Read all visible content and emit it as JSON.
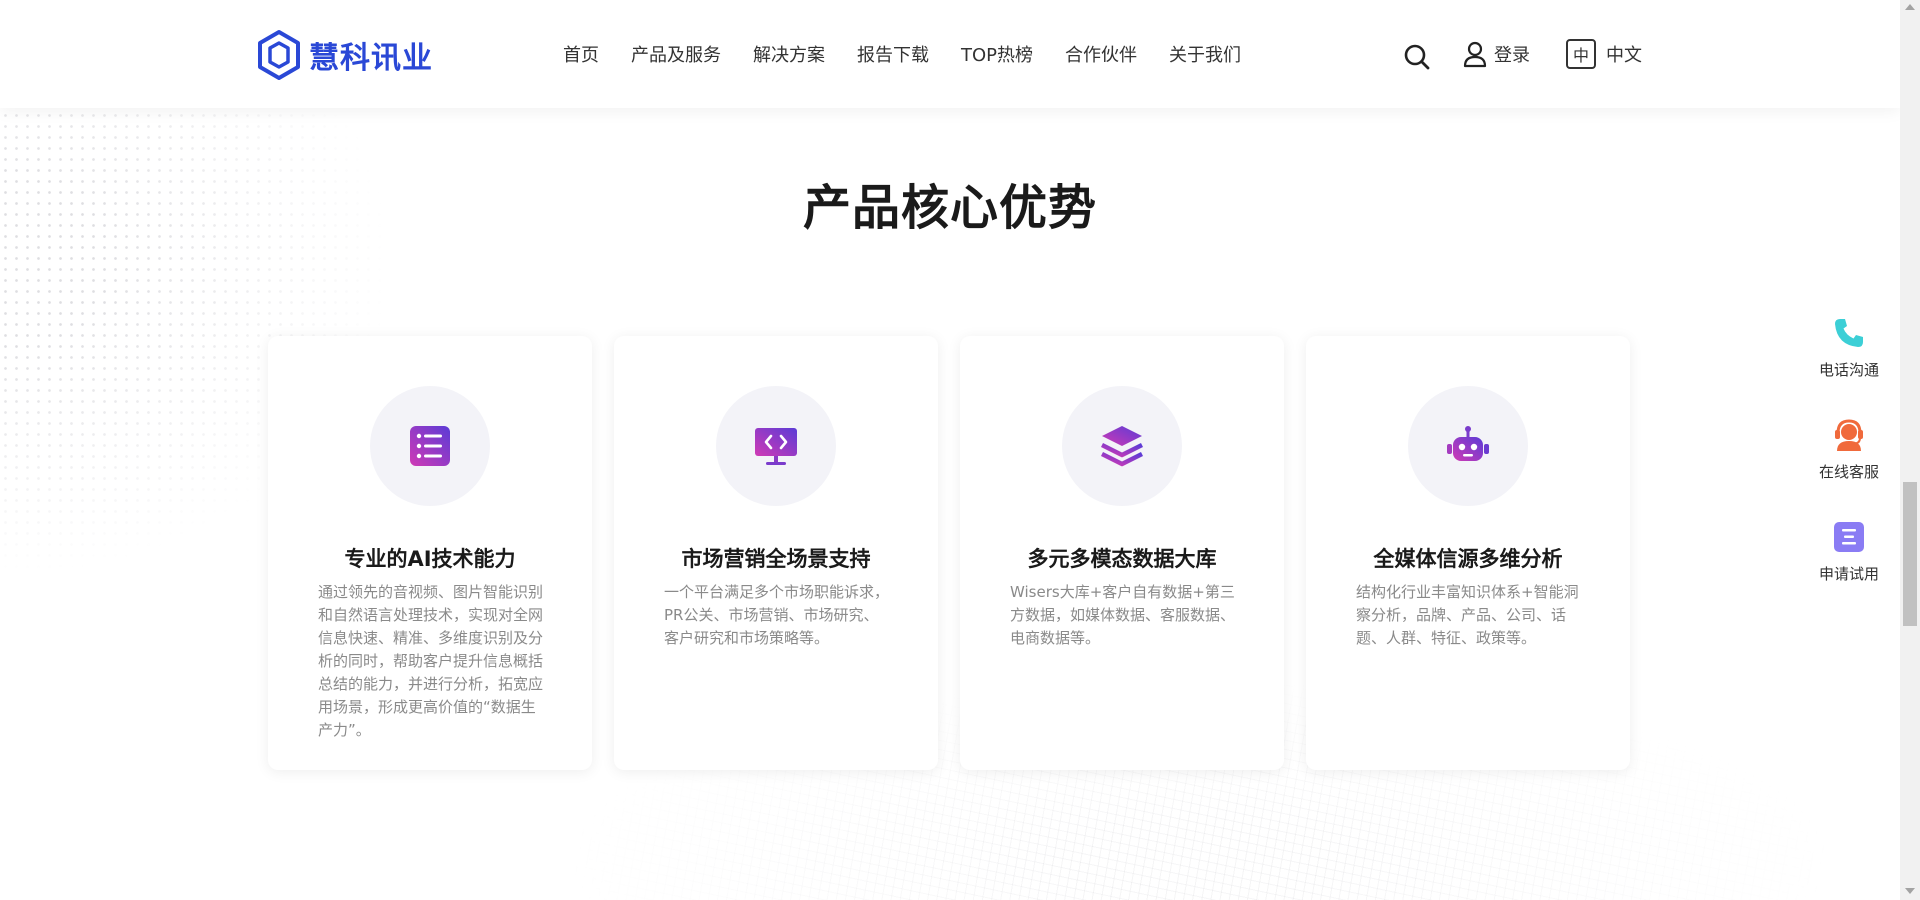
{
  "header": {
    "logo_text": "慧科讯业",
    "nav": [
      {
        "label": "首页"
      },
      {
        "label": "产品及服务"
      },
      {
        "label": "解决方案"
      },
      {
        "label": "报告下载"
      },
      {
        "label": "TOP热榜"
      },
      {
        "label": "合作伙伴"
      },
      {
        "label": "关于我们"
      }
    ],
    "login_label": "登录",
    "lang_box": "中",
    "lang_label": "中文"
  },
  "section": {
    "title": "产品核心优势",
    "cards": [
      {
        "icon": "list-icon",
        "title": "专业的AI技术能力",
        "desc": "通过领先的音视频、图片智能识别和自然语言处理技术，实现对全网信息快速、精准、多维度识别及分析的同时，帮助客户提升信息概括总结的能力，并进行分析，拓宽应用场景，形成更高价值的“数据生产力”。"
      },
      {
        "icon": "code-monitor-icon",
        "title": "市场营销全场景支持",
        "desc": "一个平台满足多个市场职能诉求，PR公关、市场营销、市场研究、客户研究和市场策略等。"
      },
      {
        "icon": "layers-icon",
        "title": "多元多模态数据大库",
        "desc": "Wisers大库+客户自有数据+第三方数据，如媒体数据、客服数据、电商数据等。"
      },
      {
        "icon": "robot-icon",
        "title": "全媒体信源多维分析",
        "desc": "结构化行业丰富知识体系+智能洞察分析，品牌、产品、公司、话题、人群、特征、政策等。"
      }
    ]
  },
  "float_bar": [
    {
      "icon": "phone-icon",
      "label": "电话沟通"
    },
    {
      "icon": "headset-icon",
      "label": "在线客服"
    },
    {
      "icon": "document-icon",
      "label": "申请试用"
    }
  ],
  "colors": {
    "brand_blue": "#2a48d6",
    "icon_gradient_start": "#d03ab5",
    "icon_gradient_end": "#5b3bd6",
    "phone_teal": "#3ccfd6",
    "service_orange": "#f06a3c",
    "trial_purple": "#8a7cf4"
  }
}
